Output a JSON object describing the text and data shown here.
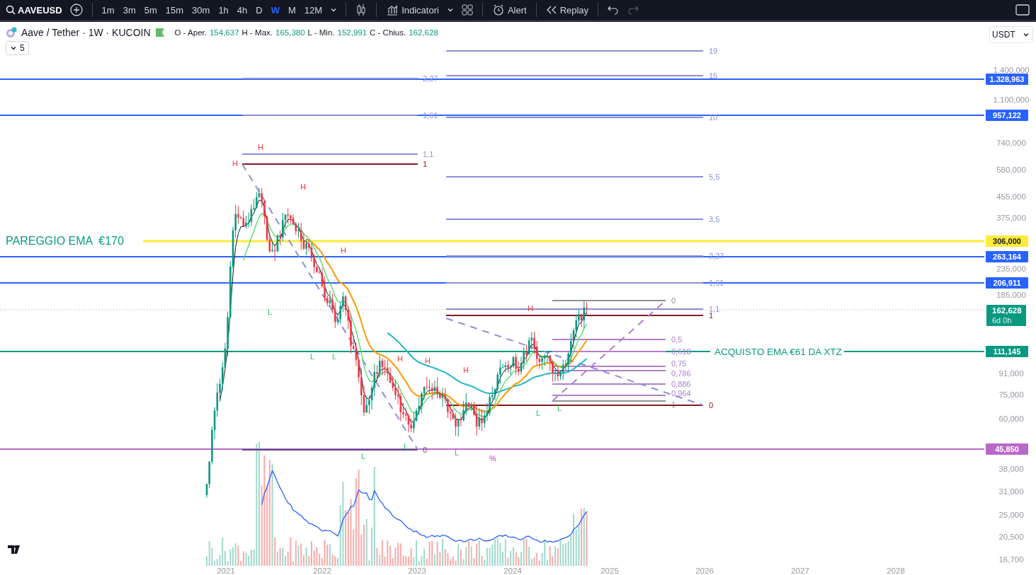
{
  "toolbar": {
    "symbol": "AAVEUSD",
    "intervals": [
      {
        "label": "1m",
        "selected": false
      },
      {
        "label": "3m",
        "selected": false
      },
      {
        "label": "5m",
        "selected": false
      },
      {
        "label": "15m",
        "selected": false
      },
      {
        "label": "30m",
        "selected": false
      },
      {
        "label": "1h",
        "selected": false
      },
      {
        "label": "4h",
        "selected": false
      },
      {
        "label": "D",
        "selected": false
      },
      {
        "label": "W",
        "selected": true
      },
      {
        "label": "M",
        "selected": false
      },
      {
        "label": "12M",
        "selected": false
      }
    ],
    "buttons": [
      {
        "kind": "indicators",
        "label": "Indicatori"
      },
      {
        "kind": "alert",
        "label": "Alert"
      },
      {
        "kind": "replay",
        "label": "Replay"
      }
    ]
  },
  "legend": {
    "title": "Aave / Tether · 1W · KUCOIN",
    "ohlc": [
      {
        "label": "O - Aper.",
        "value": "154,637"
      },
      {
        "label": "H - Max.",
        "value": "165,380"
      },
      {
        "label": "L - Min.",
        "value": "152,991"
      },
      {
        "label": "C - Chius.",
        "value": "162,628"
      }
    ],
    "indicators_count": "5"
  },
  "currency": "USDT",
  "price_lines": [
    {
      "value": "1.328,963",
      "color": "#2962ff"
    },
    {
      "value": "957,122",
      "color": "#2962ff"
    },
    {
      "value": "306,000",
      "color": "#ffeb3b",
      "note": "PAREGGIO EMA  €170"
    },
    {
      "value": "263,164",
      "color": "#2962ff"
    },
    {
      "value": "206,911",
      "color": "#2962ff"
    },
    {
      "value": "111,145",
      "color": "#089981",
      "note": "ACQUISTO EMA €61 DA XTZ"
    },
    {
      "value": "45,850",
      "color": "#ba68c8"
    }
  ],
  "current_price": {
    "value": "162,628",
    "countdown": "6d 0h"
  },
  "fib_levels": [
    {
      "levels": [
        {
          "label": "2,27",
          "color": "#8a8fd4"
        },
        {
          "label": "1,61",
          "color": "#8a8fd4"
        },
        {
          "label": "1,1",
          "color": "#8a8fd4"
        },
        {
          "label": "1",
          "color": "#801922"
        },
        {
          "label": "0",
          "color": "#5d4a8a"
        }
      ]
    },
    {
      "levels": [
        {
          "label": "0",
          "color": "#8f9099"
        },
        {
          "label": "0,5",
          "color": "#b07fcf"
        },
        {
          "label": "0,618",
          "color": "#b07fcf"
        },
        {
          "label": "0,75",
          "color": "#b07fcf"
        },
        {
          "label": "0,786",
          "color": "#b07fcf"
        },
        {
          "label": "0,886",
          "color": "#b07fcf"
        },
        {
          "label": "0,964",
          "color": "#b07fcf"
        },
        {
          "label": "1",
          "color": "#8f9099"
        }
      ]
    },
    {
      "levels": [
        {
          "label": "19",
          "color": "#8a8fd4"
        },
        {
          "label": "15",
          "color": "#8a8fd4"
        },
        {
          "label": "10",
          "color": "#8a8fd4"
        },
        {
          "label": "5,5",
          "color": "#8a8fd4"
        },
        {
          "label": "3,5",
          "color": "#8a8fd4"
        },
        {
          "label": "2,27",
          "color": "#8a8fd4"
        },
        {
          "label": "1,61",
          "color": "#8a8fd4"
        },
        {
          "label": "1,1",
          "color": "#8a8fd4"
        },
        {
          "label": "1",
          "color": "#801922"
        },
        {
          "label": "0",
          "color": "#801922"
        }
      ]
    }
  ],
  "pivots": [
    {
      "kind": "high",
      "label": "H"
    },
    {
      "kind": "high",
      "label": "H"
    },
    {
      "kind": "high",
      "label": "H"
    },
    {
      "kind": "high",
      "label": "H"
    },
    {
      "kind": "high",
      "label": "H"
    },
    {
      "kind": "high",
      "label": "H"
    },
    {
      "kind": "high",
      "label": "H"
    },
    {
      "kind": "high",
      "label": "H"
    },
    {
      "kind": "low",
      "label": "L"
    },
    {
      "kind": "low",
      "label": "L"
    },
    {
      "kind": "low",
      "label": "L"
    },
    {
      "kind": "low",
      "label": "L"
    },
    {
      "kind": "low",
      "label": "L"
    },
    {
      "kind": "low",
      "label": "L"
    },
    {
      "kind": "low",
      "label": "L"
    },
    {
      "kind": "low",
      "label": "L"
    },
    {
      "kind": "mark",
      "label": "%"
    }
  ],
  "price_axis": {
    "ticks": [
      "1.400,000",
      "1.100,000",
      "740,000",
      "580,000",
      "455,000",
      "375,000",
      "235,000",
      "185,000",
      "91,000",
      "75,000",
      "60,000",
      "38,000",
      "31,000",
      "25,000",
      "20,500",
      "16,700"
    ]
  },
  "time_axis": {
    "labels": [
      "2021",
      "2022",
      "2023",
      "2024",
      "2025",
      "2026",
      "2027",
      "2028"
    ]
  }
}
